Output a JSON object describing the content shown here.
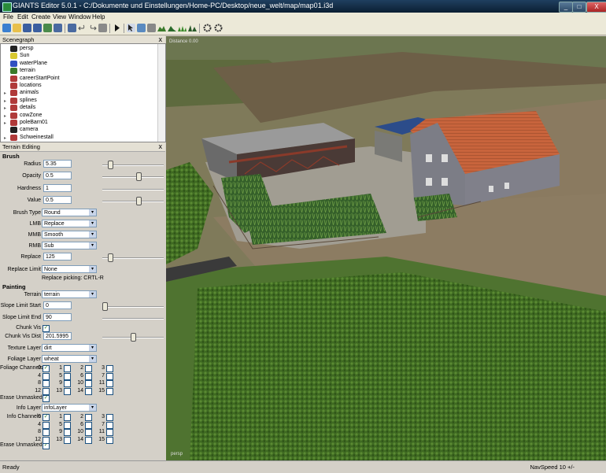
{
  "window": {
    "title": "GIANTS Editor 5.0.1 - C:/Dokumente und Einstellungen/Home-PC/Desktop/neue_welt/map/map01.i3d",
    "min": "_",
    "max": "□",
    "close": "X"
  },
  "menu": [
    "File",
    "Edit",
    "Create",
    "View",
    "Window",
    "Help"
  ],
  "toolbar_icons": [
    "new-icon",
    "open-icon",
    "save-icon",
    "save-as-icon",
    "import-icon",
    "export-icon",
    "undo-icon",
    "redo-icon",
    "play-icon",
    "select-icon",
    "move-icon",
    "terrain-sculpt-icon",
    "terrain-paint-icon",
    "foliage-paint-icon",
    "grass-icon",
    "settings-icon",
    "camera-icon"
  ],
  "scenegraph": {
    "title": "Scenegraph",
    "close": "x",
    "nodes": [
      {
        "label": "persp",
        "icon": "camera-icon",
        "expand": ""
      },
      {
        "label": "Sun",
        "icon": "light-icon",
        "expand": ""
      },
      {
        "label": "waterPlane",
        "icon": "shape-icon",
        "expand": ""
      },
      {
        "label": "terrain",
        "icon": "terrain-icon",
        "expand": ""
      },
      {
        "label": "careerStartPoint",
        "icon": "transform-icon",
        "expand": ""
      },
      {
        "label": "locations",
        "icon": "transform-icon",
        "expand": ""
      },
      {
        "label": "animals",
        "icon": "transform-icon",
        "expand": "▸"
      },
      {
        "label": "splines",
        "icon": "transform-icon",
        "expand": "▸"
      },
      {
        "label": "details",
        "icon": "transform-icon",
        "expand": "▸"
      },
      {
        "label": "cowZone",
        "icon": "transform-icon",
        "expand": "▸"
      },
      {
        "label": "poleBarn01",
        "icon": "transform-icon",
        "expand": "▸"
      },
      {
        "label": "camera",
        "icon": "camera-icon",
        "expand": ""
      },
      {
        "label": "Schweinestall",
        "icon": "transform-icon",
        "expand": "▸"
      }
    ]
  },
  "terrain_editing": {
    "title": "Terrain Editing",
    "close": "x",
    "brush_heading": "Brush",
    "radius_label": "Radius",
    "radius": "5.35",
    "radius_level": 0.1,
    "opacity_label": "Opacity",
    "opacity": "0.5",
    "opacity_level": 0.6,
    "hardness_label": "Hardness",
    "hardness": "1",
    "value_label": "Value",
    "value": "0.5",
    "value_level": 0.6,
    "brush_type_label": "Brush Type",
    "brush_type": "Round",
    "lmb_label": "LMB",
    "lmb": "Replace",
    "mmb_label": "MMB",
    "mmb": "Smooth",
    "rmb_label": "RMB",
    "rmb": "Sub",
    "replace_label": "Replace",
    "replace": "125",
    "replace_level": 0.1,
    "replace_limit_label": "Replace Limit",
    "replace_limit": "None",
    "replace_picking": "Replace picking: CRTL-R",
    "painting_heading": "Painting",
    "terrain_label": "Terrain",
    "terrain": "terrain",
    "slope_start_label": "Slope Limit Start",
    "slope_start": "0",
    "slope_end_label": "Slope Limit End",
    "slope_end": "90",
    "chunk_vis_label": "Chunk Vis",
    "chunk_vis_dist_label": "Chunk Vis Dist",
    "chunk_vis_dist": "201.5995",
    "chunk_vis_dist_level": 0.5,
    "texture_layer_label": "Texture Layer",
    "texture_layer": "dirt",
    "foliage_layer_label": "Foliage Layer",
    "foliage_layer": "wheat",
    "foliage_channels_label": "Foliage Channels",
    "erase_unmasked_label": "Erase Unmasked",
    "info_layer_label": "Info Layer",
    "info_layer": "infoLayer",
    "info_channels_label": "Info Channels",
    "erase_unmasked2_label": "Erase Unmasked",
    "channels": [
      "0",
      "1",
      "2",
      "3",
      "4",
      "5",
      "6",
      "7",
      "8",
      "9",
      "10",
      "11",
      "12",
      "13",
      "14",
      "15"
    ],
    "foliage_checked": [
      "0"
    ],
    "info_checked": [
      "0"
    ],
    "check_mark": "✓"
  },
  "viewport": {
    "distance": "Distance 0.00",
    "camera_label": "persp"
  },
  "status": {
    "text": "Ready",
    "navspeed": "NavSpeed 10 +/-"
  }
}
